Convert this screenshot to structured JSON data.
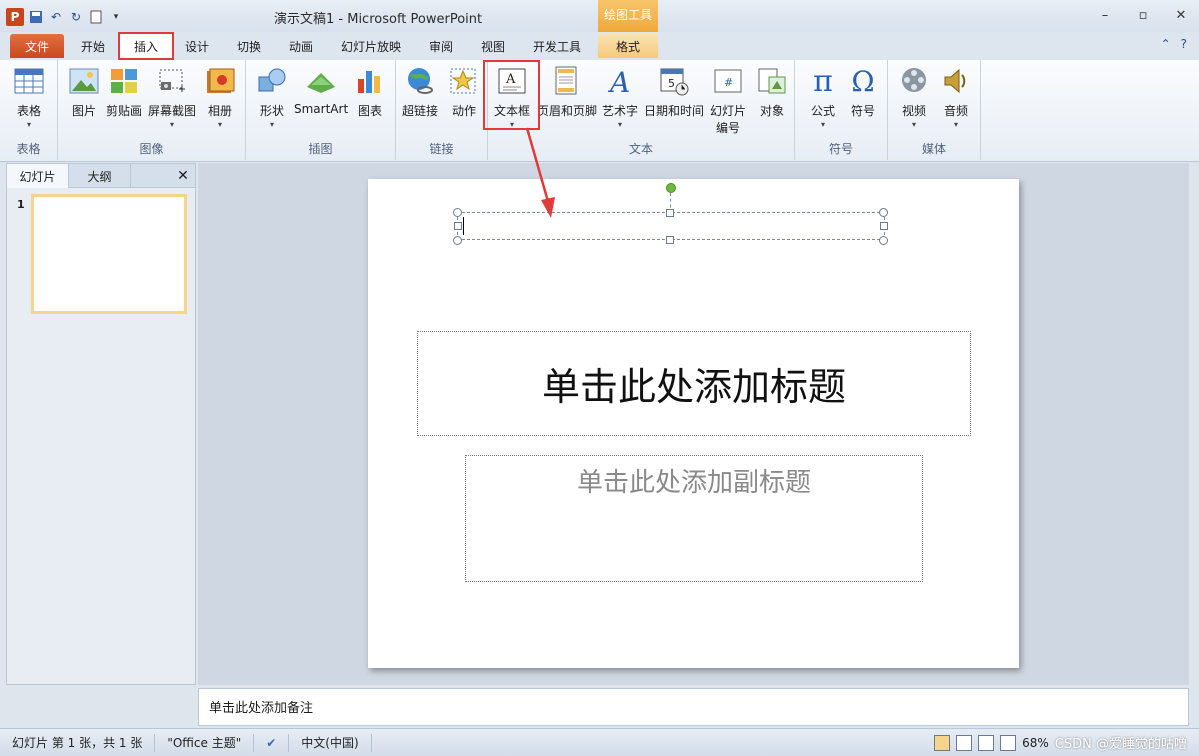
{
  "window": {
    "title": "演示文稿1 - Microsoft PowerPoint",
    "context_tab_group": "绘图工具"
  },
  "qat": {
    "app_icon": "P",
    "save_icon": "save-icon",
    "undo_icon": "undo-icon",
    "redo_icon": "redo-icon",
    "new_icon": "new-doc-icon"
  },
  "tabs": {
    "file": "文件",
    "home": "开始",
    "insert": "插入",
    "design": "设计",
    "transitions": "切换",
    "animations": "动画",
    "slideshow": "幻灯片放映",
    "review": "审阅",
    "view": "视图",
    "developer": "开发工具",
    "format": "格式"
  },
  "ribbon": {
    "groups": {
      "table": "表格",
      "images": "图像",
      "illustrations": "插图",
      "links": "链接",
      "text": "文本",
      "symbols": "符号",
      "media": "媒体"
    },
    "buttons": {
      "table": "表格",
      "picture": "图片",
      "clipart": "剪贴画",
      "screenshot": "屏幕截图",
      "album": "相册",
      "shapes": "形状",
      "smartart": "SmartArt",
      "chart": "图表",
      "hyperlink": "超链接",
      "action": "动作",
      "textbox": "文本框",
      "header_footer": "页眉和页脚",
      "wordart": "艺术字",
      "datetime": "日期和时间",
      "slide_number_1": "幻灯片",
      "slide_number_2": "编号",
      "object": "对象",
      "equation": "公式",
      "symbol": "符号",
      "video": "视频",
      "audio": "音频"
    }
  },
  "left_panel": {
    "tab_slides": "幻灯片",
    "tab_outline": "大纲",
    "slide_number": "1"
  },
  "slide": {
    "title_placeholder": "单击此处添加标题",
    "subtitle_placeholder": "单击此处添加副标题"
  },
  "notes": {
    "placeholder": "单击此处添加备注"
  },
  "status": {
    "slide_info": "幻灯片 第 1 张，共 1 张",
    "theme": "\"Office 主题\"",
    "language": "中文(中国)",
    "zoom": "68%",
    "watermark": "CSDN @爱睡觉的咕噜"
  },
  "colors": {
    "accent_red": "#e03a3a",
    "file_tab": "#c94a1e",
    "format_tab": "#f0a83a"
  }
}
